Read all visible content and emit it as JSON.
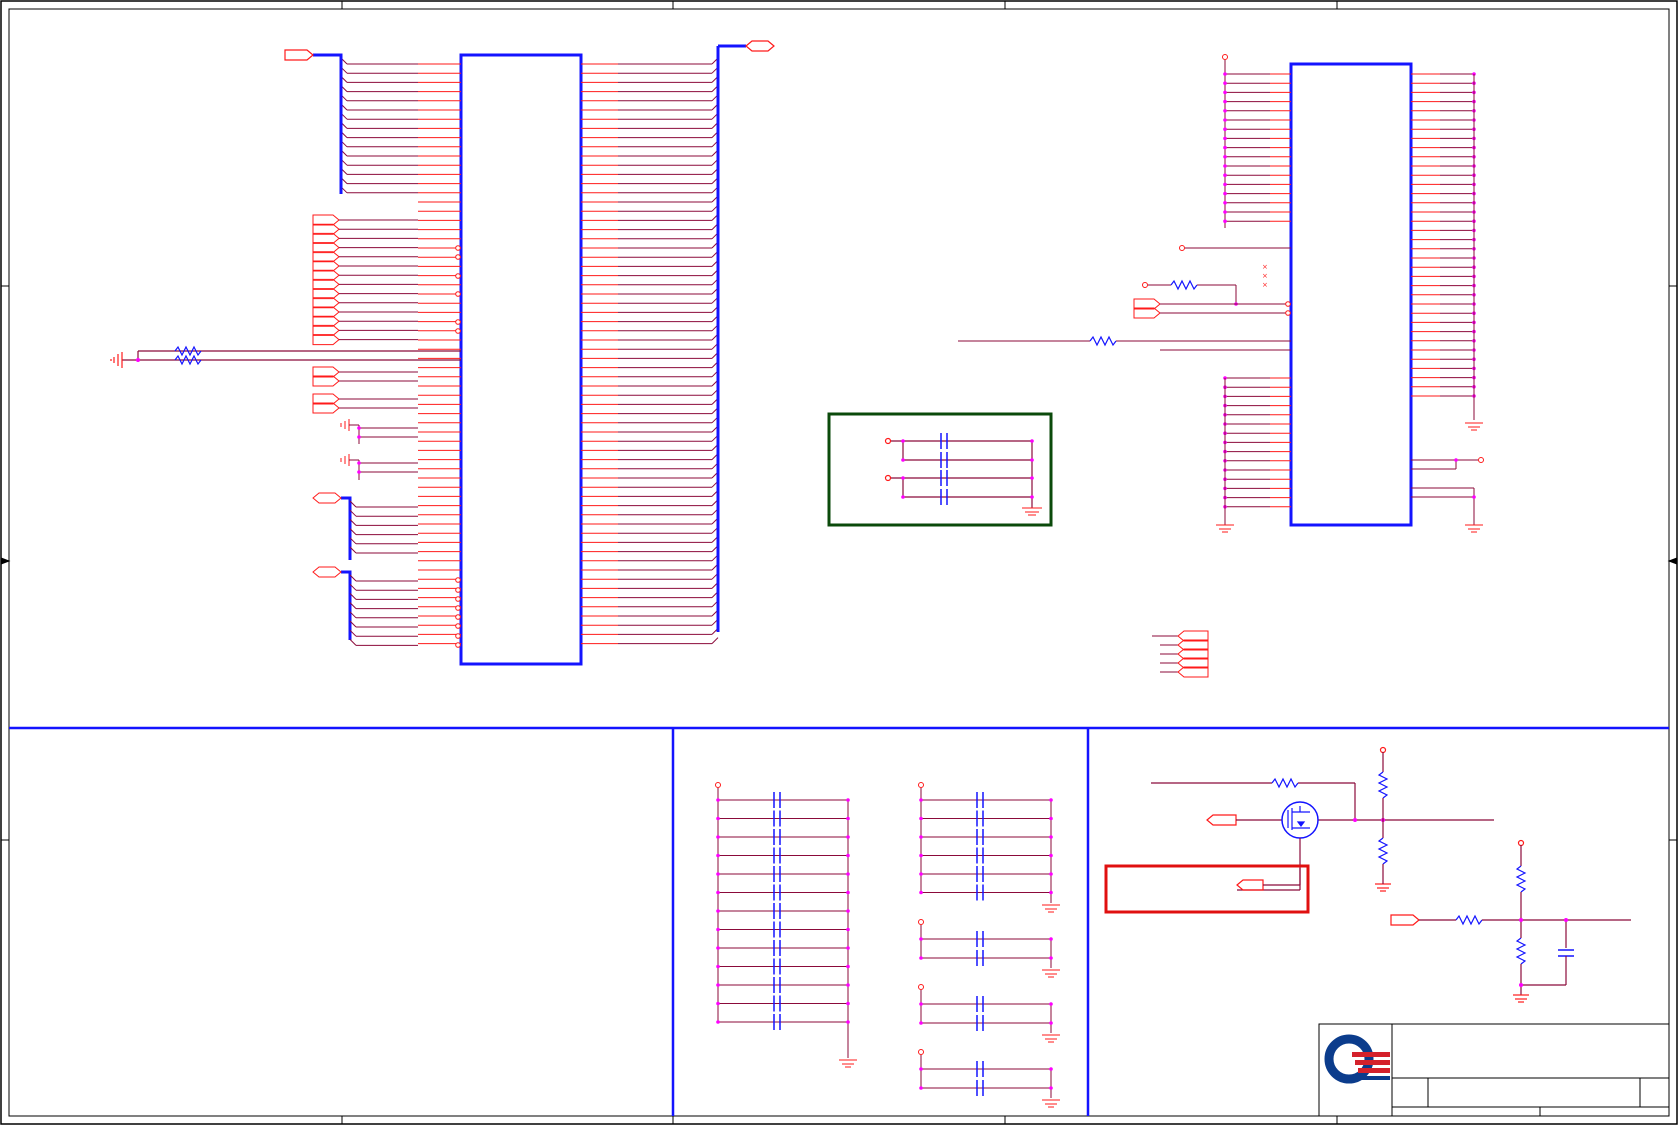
{
  "sheet": {
    "type": "electronic schematic sheet (no legible text)",
    "colors": {
      "background": "#ffffff",
      "border": "#000000",
      "wire": "#8b0a3a",
      "pin": "#ff1a1a",
      "component_outline": "#1414ff",
      "junction": "#ff00ff",
      "decoupling_box": "#0b4a0b",
      "note_box": "#e01010",
      "logo_blue": "#0b3c8c",
      "logo_red": "#d4212b"
    }
  },
  "regions": [
    {
      "id": "main-connector",
      "kind": "ic-symbol",
      "label": ""
    },
    {
      "id": "secondary-ic",
      "kind": "ic-symbol",
      "label": ""
    },
    {
      "id": "decoupling-box",
      "kind": "annotation-box",
      "label": ""
    },
    {
      "id": "capacitor-bank-left",
      "kind": "capacitor-array",
      "label": ""
    },
    {
      "id": "capacitor-bank-right",
      "kind": "capacitor-array",
      "label": ""
    },
    {
      "id": "mosfet-circuit",
      "kind": "switch-circuit",
      "label": ""
    },
    {
      "id": "divider-circuit",
      "kind": "resistor-divider",
      "label": ""
    },
    {
      "id": "title-block",
      "kind": "title-block",
      "label": ""
    }
  ],
  "icons": [
    "ground-symbol-icon",
    "resistor-icon",
    "capacitor-icon",
    "mosfet-icon",
    "company-logo-icon",
    "off-page-connector-icon"
  ]
}
